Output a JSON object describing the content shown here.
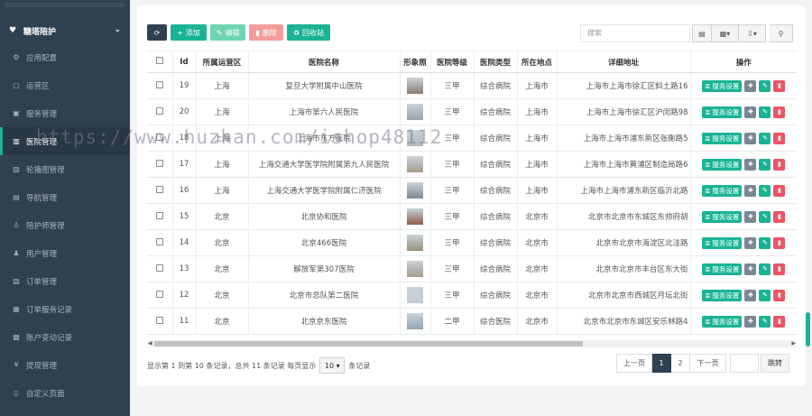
{
  "sidebar": {
    "header": "糖塔陪护",
    "items": [
      {
        "label": "应用配置",
        "icon": "gear-icon"
      },
      {
        "label": "运营区",
        "icon": "map-icon"
      },
      {
        "label": "服务管理",
        "icon": "folder-icon"
      },
      {
        "label": "医院管理",
        "icon": "hospital-icon"
      },
      {
        "label": "轮播图管理",
        "icon": "image-icon"
      },
      {
        "label": "导航管理",
        "icon": "nav-icon"
      },
      {
        "label": "陪护师管理",
        "icon": "user-icon"
      },
      {
        "label": "用户管理",
        "icon": "person-icon"
      },
      {
        "label": "订单管理",
        "icon": "order-icon"
      },
      {
        "label": "订单服务记录",
        "icon": "record-icon"
      },
      {
        "label": "账户变动记录",
        "icon": "wallet-icon"
      },
      {
        "label": "提现管理",
        "icon": "yen-icon"
      },
      {
        "label": "自定义页面",
        "icon": "page-icon"
      }
    ],
    "active_index": 3
  },
  "toolbar": {
    "add": "添加",
    "edit": "编辑",
    "delete": "删除",
    "recycle": "回收站"
  },
  "search": {
    "placeholder": "搜索"
  },
  "table": {
    "columns": [
      "",
      "Id",
      "所属运营区",
      "医院名称",
      "形象照",
      "医院等级",
      "医院类型",
      "所在地点",
      "详细地址",
      "操作"
    ],
    "service_label": "服务设置",
    "rows": [
      {
        "id": "19",
        "region": "上海",
        "name": "复旦大学附属中山医院",
        "level": "三甲",
        "type": "综合病院",
        "city": "上海市",
        "addr": "上海市上海市徐汇区斜土路16"
      },
      {
        "id": "20",
        "region": "上海",
        "name": "上海市第六人民医院",
        "level": "三甲",
        "type": "综合病院",
        "city": "上海市",
        "addr": "上海市上海市徐汇区沪闵路98"
      },
      {
        "id": "18",
        "region": "上海",
        "name": "上海市东方医院",
        "level": "三甲",
        "type": "综合病院",
        "city": "上海市",
        "addr": "上海市上海市浦东新区张衡路5"
      },
      {
        "id": "17",
        "region": "上海",
        "name": "上海交通大学医学院附属第九人民医院",
        "level": "三甲",
        "type": "综合病院",
        "city": "上海市",
        "addr": "上海市上海市黄浦区制造局路6"
      },
      {
        "id": "16",
        "region": "上海",
        "name": "上海交通大学医学院附属仁济医院",
        "level": "三甲",
        "type": "综合病院",
        "city": "上海市",
        "addr": "上海市上海市浦东新区临沂北路"
      },
      {
        "id": "15",
        "region": "北京",
        "name": "北京协和医院",
        "level": "三甲",
        "type": "综合病院",
        "city": "北京市",
        "addr": "北京市北京市东城区东帅府胡"
      },
      {
        "id": "14",
        "region": "北京",
        "name": "北京466医院",
        "level": "三甲",
        "type": "综合病院",
        "city": "北京市",
        "addr": "北京市北京市海淀区北洼路"
      },
      {
        "id": "13",
        "region": "北京",
        "name": "解放军第307医院",
        "level": "三甲",
        "type": "综合病院",
        "city": "北京市",
        "addr": "北京市北京市丰台区东大街"
      },
      {
        "id": "12",
        "region": "北京",
        "name": "北京市总队第二医院",
        "level": "三甲",
        "type": "综合病院",
        "city": "北京市",
        "addr": "北京市北京市西城区月坛北街"
      },
      {
        "id": "11",
        "region": "北京",
        "name": "北京京东医院",
        "level": "二甲",
        "type": "综合医院",
        "city": "北京市",
        "addr": "北京市北京市东城区安乐林路4"
      }
    ]
  },
  "footer": {
    "info_before": "显示第 1 到第 10 条记录，总共 11 条记录 每页显示",
    "page_size": "10",
    "info_after": "条记录"
  },
  "pager": {
    "prev": "上一页",
    "pages": [
      "1",
      "2"
    ],
    "next": "下一页",
    "go": "跳转"
  },
  "watermark": "https://www.huzhan.com/ishop48112",
  "colors": {
    "accent": "#1ab394",
    "sidebar": "#2f4050",
    "danger": "#ed5565"
  }
}
